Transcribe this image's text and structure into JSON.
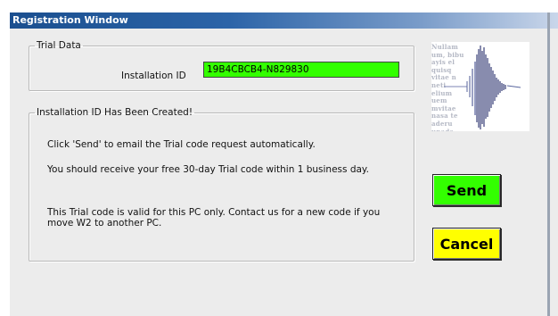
{
  "window": {
    "title": "Registration Window"
  },
  "trial_data": {
    "legend": "Trial Data",
    "installation_id_label": "Installation ID",
    "installation_id_value": "19B4CBCB4-N829830"
  },
  "info": {
    "legend": "Installation ID Has Been Created!",
    "line1": "Click 'Send' to email the Trial code request automatically.",
    "line2": "You should receive your free 30-day Trial code within 1 business day.",
    "line3": "This Trial code is valid for this PC only. Contact us for a new code if you move W2 to another PC."
  },
  "buttons": {
    "send": "Send",
    "cancel": "Cancel"
  },
  "colors": {
    "id_field": "#33ff00",
    "send": "#33ff00",
    "cancel": "#ffff00",
    "title_start": "#1b4f8f"
  },
  "logo": {
    "icon": "waveform-logo-icon"
  }
}
